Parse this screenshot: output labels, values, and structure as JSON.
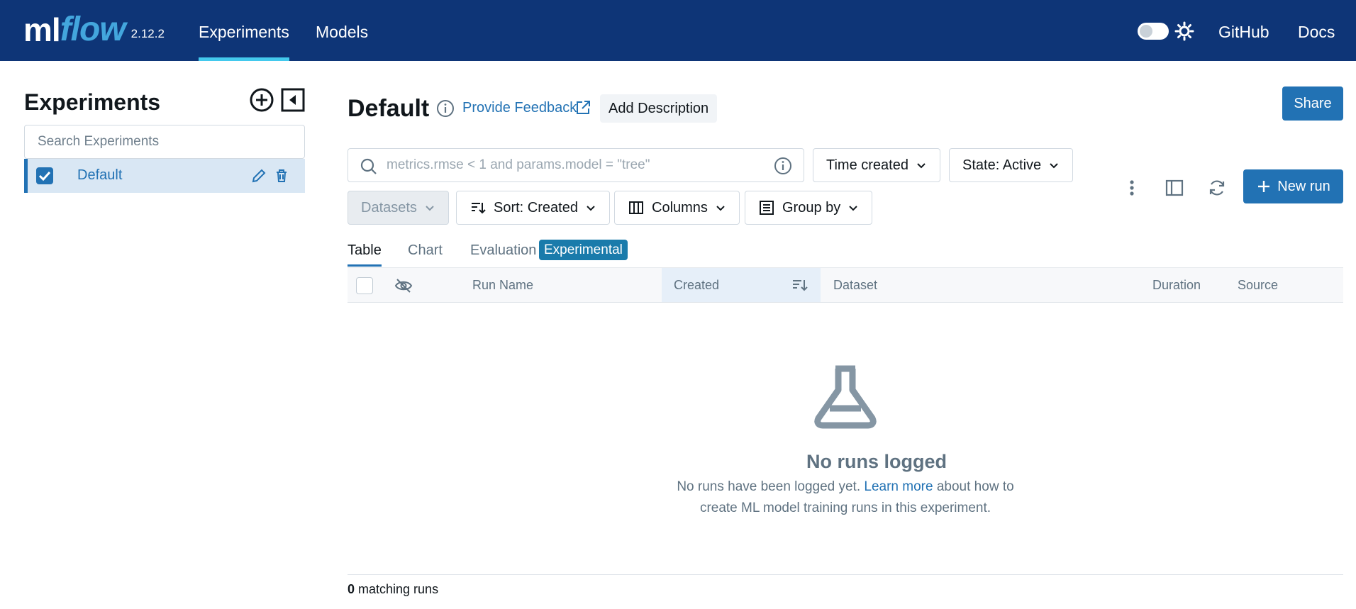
{
  "nav": {
    "logo_ml": "ml",
    "logo_flow": "flow",
    "version": "2.12.2",
    "links": [
      {
        "label": "Experiments",
        "active": true
      },
      {
        "label": "Models",
        "active": false
      }
    ],
    "github": "GitHub",
    "docs": "Docs"
  },
  "sidebar": {
    "title": "Experiments",
    "search_placeholder": "Search Experiments",
    "experiments": [
      {
        "name": "Default",
        "checked": true
      }
    ]
  },
  "header": {
    "title": "Default",
    "feedback": "Provide Feedback",
    "add_description": "Add Description",
    "share": "Share"
  },
  "controls": {
    "filter_placeholder": "metrics.rmse < 1 and params.model = \"tree\"",
    "time_created": "Time created",
    "state": "State: Active",
    "datasets": "Datasets",
    "sort": "Sort: Created",
    "columns": "Columns",
    "group_by": "Group by",
    "new_run": "New run"
  },
  "tabs": [
    {
      "label": "Table",
      "active": true
    },
    {
      "label": "Chart",
      "active": false
    },
    {
      "label": "Evaluation",
      "active": false
    }
  ],
  "badge": "Experimental",
  "table": {
    "columns": [
      "Run Name",
      "Created",
      "Dataset",
      "Duration",
      "Source"
    ]
  },
  "empty": {
    "title": "No runs logged",
    "text_before": "No runs have been logged yet. ",
    "link": "Learn more",
    "text_after": " about how to create ML model training runs in this experiment."
  },
  "footer": {
    "count": "0",
    "label": " matching runs"
  },
  "colors": {
    "nav_bg": "#0e3577",
    "accent": "#2272b4",
    "badge": "#1a7bab"
  }
}
